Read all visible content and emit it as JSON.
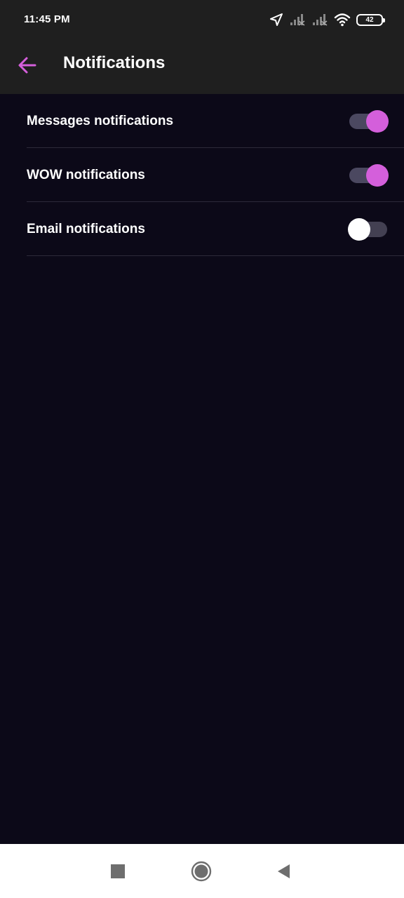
{
  "status_bar": {
    "time": "11:45 PM",
    "battery_level": "42",
    "icons": [
      "location-icon",
      "signal-icon",
      "signal-icon",
      "wifi-icon",
      "battery-icon"
    ]
  },
  "app_bar": {
    "title": "Notifications",
    "back_icon": "arrow-left-icon"
  },
  "settings": [
    {
      "label": "Messages notifications",
      "enabled": true
    },
    {
      "label": "WOW notifications",
      "enabled": true
    },
    {
      "label": "Email notifications",
      "enabled": false
    }
  ],
  "colors": {
    "accent": "#d45fdb",
    "background": "#0c0918",
    "app_bar": "#1f1f1f",
    "toggle_off_thumb": "#ffffff"
  },
  "nav_bar": {
    "icons": [
      "recent-apps-icon",
      "home-icon",
      "back-triangle-icon"
    ]
  }
}
